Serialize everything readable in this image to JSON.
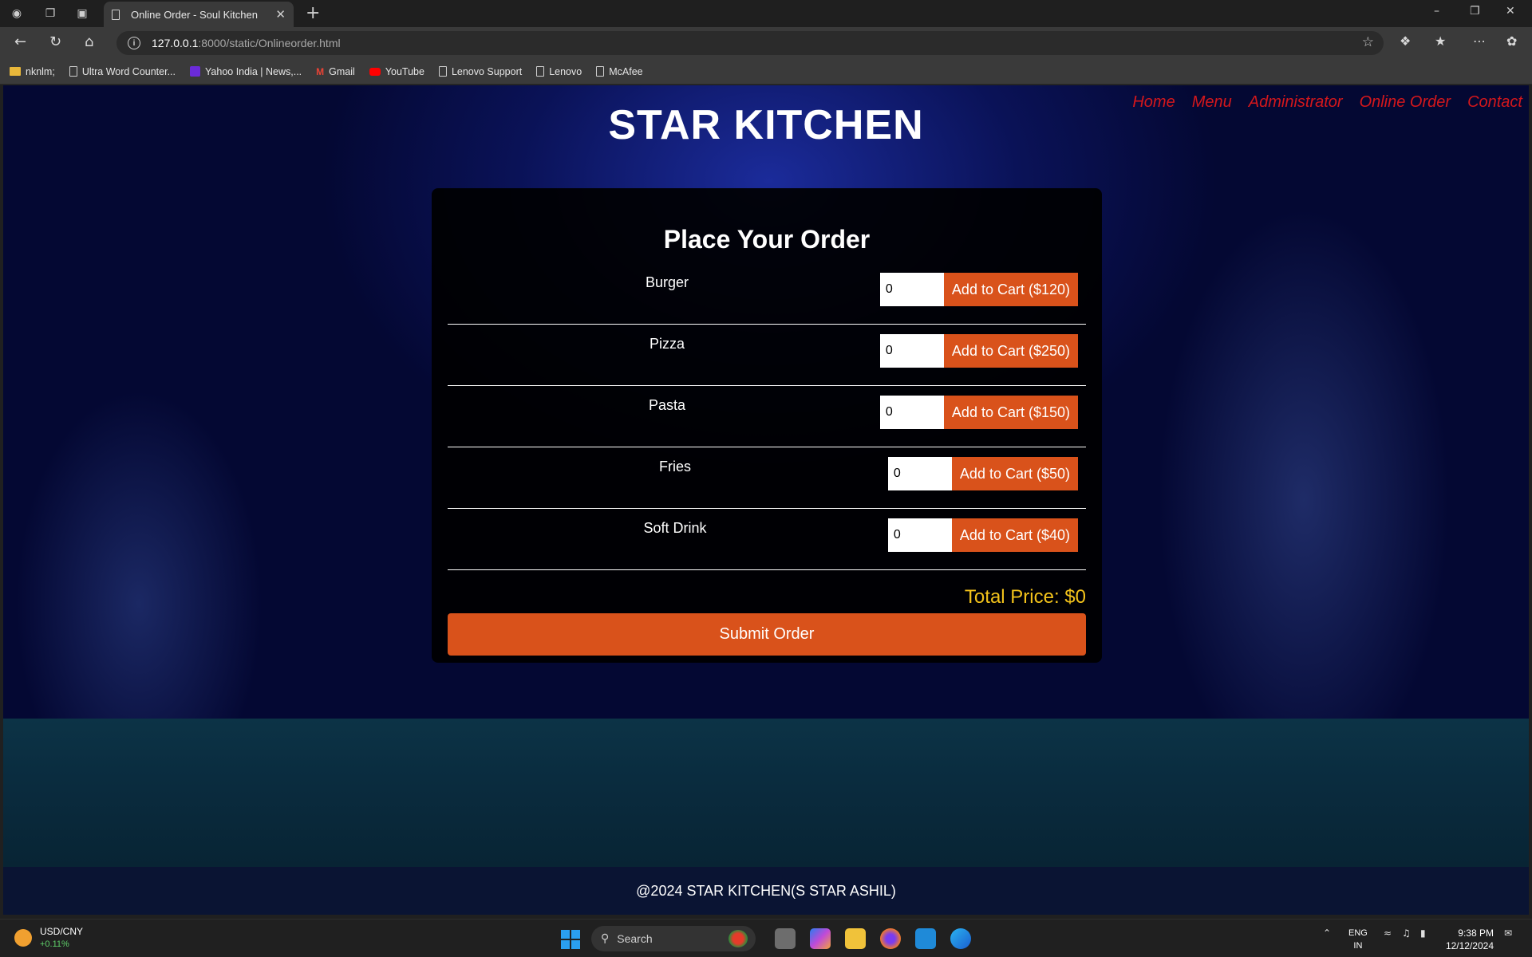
{
  "browser": {
    "tab_title": "Online Order - Soul Kitchen",
    "url_host": "127.0.0.1",
    "url_path": ":8000/static/Onlineorder.html",
    "bookmarks": [
      "nknlm;",
      "Ultra Word Counter...",
      "Yahoo India | News,...",
      "Gmail",
      "YouTube",
      "Lenovo Support",
      "Lenovo",
      "McAfee"
    ]
  },
  "site": {
    "brand": "STAR KITCHEN",
    "nav": [
      "Home",
      "Menu",
      "Administrator",
      "Online Order",
      "Contact"
    ]
  },
  "order": {
    "heading": "Place Your Order",
    "items": [
      {
        "name": "Burger",
        "qty": "0",
        "button": "Add to Cart ($120)"
      },
      {
        "name": "Pizza",
        "qty": "0",
        "button": "Add to Cart ($250)"
      },
      {
        "name": "Pasta",
        "qty": "0",
        "button": "Add to Cart ($150)"
      },
      {
        "name": "Fries",
        "qty": "0",
        "button": "Add to Cart ($50)"
      },
      {
        "name": "Soft Drink",
        "qty": "0",
        "button": "Add to Cart ($40)"
      }
    ],
    "total": "Total Price: $0",
    "submit": "Submit Order"
  },
  "footer": {
    "text": "@2024 STAR KITCHEN(S STAR ASHIL)"
  },
  "taskbar": {
    "ticker_name": "USD/CNY",
    "ticker_change": "+0.11%",
    "search": "Search",
    "lang_1": "ENG",
    "lang_2": "IN",
    "time": "9:38 PM",
    "date": "12/12/2024"
  },
  "colors": {
    "accent": "#d9521b",
    "nav_link": "#d4171c",
    "total": "#f2c21b"
  }
}
